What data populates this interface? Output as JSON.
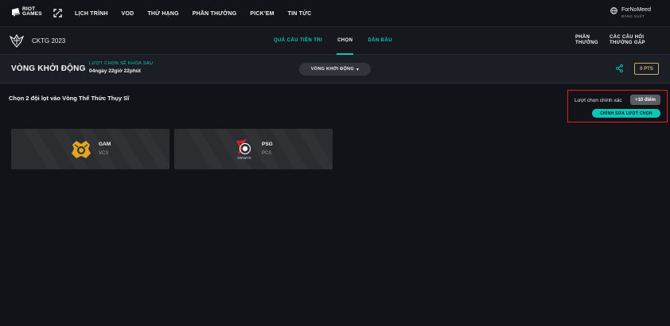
{
  "topnav": {
    "logo_text_line1": "RIOT",
    "logo_text_line2": "GAMES",
    "links": [
      "LỊCH TRÌNH",
      "VOD",
      "THỨ HẠNG",
      "PHẦN THƯỞNG",
      "PICK'EM",
      "TIN TỨC"
    ],
    "user_name": "ForNoMeed",
    "logout_label": "ĐĂNG XUẤT"
  },
  "subnav": {
    "event_name": "CKTG 2023",
    "tabs": [
      {
        "label": "QUẢ CẦU TIÊN TRI",
        "active": false
      },
      {
        "label": "CHỌN",
        "active": true
      },
      {
        "label": "DẪN ĐẦU",
        "active": false
      }
    ],
    "right_links": [
      {
        "line1": "PHẦN",
        "line2": "THƯỞNG"
      },
      {
        "line1": "CÁC CÂU HỎI",
        "line2": "THƯỜNG GẶP"
      }
    ]
  },
  "stage": {
    "title": "VÒNG KHỞI ĐỘNG",
    "lock_label": "LƯỢT CHỌN SẼ KHÓA SAU",
    "lock_time": "04ngày 22giờ 22phút",
    "stage_select": "VÒNG KHỞI ĐỘNG",
    "points": "0 PTS"
  },
  "pick": {
    "section_title": "Chọn 2 đội lọt vào Vòng Thể Thức Thụy Sĩ",
    "correct_label": "Lượt chọn chính xác",
    "bonus": "+10 điểm",
    "edit_button": "CHỈNH SỬA LƯỢT CHỌN"
  },
  "teams": [
    {
      "name": "GAM",
      "region": "VCS"
    },
    {
      "name": "PSG",
      "region": "PCS",
      "logo_text": "ESPORTS"
    }
  ],
  "colors": {
    "accent": "#0ac8b9",
    "gold": "#c8aa6e",
    "highlight": "#e02020"
  }
}
